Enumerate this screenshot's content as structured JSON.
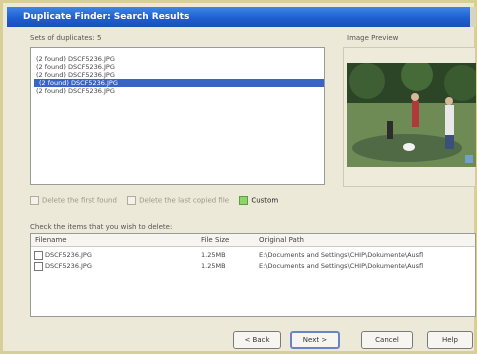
{
  "window": {
    "title": "Duplicate Finder: Search Results"
  },
  "duplicates_panel": {
    "label": "Sets of duplicates: 5",
    "items": [
      {
        "label": "(2 found) DSCF5236.JPG",
        "selected": false
      },
      {
        "label": "(2 found) DSCF5236.JPG",
        "selected": false
      },
      {
        "label": "(2 found) DSCF5236.JPG",
        "selected": false
      },
      {
        "label": "(2 found) DSCF5236.JPG",
        "selected": true
      },
      {
        "label": "(2 found) DSCF5236.JPG",
        "selected": false
      }
    ]
  },
  "preview": {
    "label": "Image Preview"
  },
  "options": {
    "opt1": "Delete the first found",
    "opt2": "Delete the last copied file",
    "opt3": "Custom"
  },
  "files": {
    "instruction": "Check the items that you wish to delete:",
    "columns": {
      "name": "Filename",
      "size": "File Size",
      "path": "Original Path"
    },
    "rows": [
      {
        "name": "DSCF5236.JPG",
        "size": "1.25MB",
        "path": "E:\\Documents and Settings\\CHIP\\Dokumente\\Ausfl"
      },
      {
        "name": "DSCF5236.JPG",
        "size": "1.25MB",
        "path": "E:\\Documents and Settings\\CHIP\\Dokumente\\Ausfl"
      }
    ]
  },
  "buttons": {
    "back": "< Back",
    "next": "Next >",
    "cancel": "Cancel",
    "help": "Help"
  }
}
